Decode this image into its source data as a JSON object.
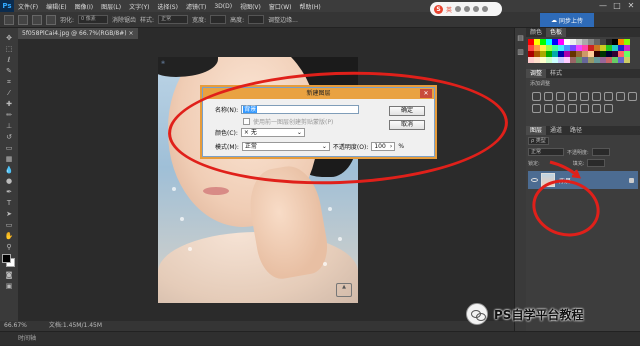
{
  "app": {
    "logo": "Ps"
  },
  "menubar": {
    "items": [
      "文件(F)",
      "编辑(E)",
      "图像(I)",
      "图层(L)",
      "文字(Y)",
      "选择(S)",
      "滤镜(T)",
      "3D(D)",
      "视图(V)",
      "窗口(W)",
      "帮助(H)"
    ]
  },
  "options": {
    "feather_label": "羽化:",
    "feather_value": "0 像素",
    "antialias": "消除锯齿",
    "style_label": "样式:",
    "style_value": "正常",
    "width_label": "宽度:",
    "height_label": "高度:",
    "refine": "调整边缘..."
  },
  "ime": {
    "label": "英",
    "icons": [
      "moon",
      "dot",
      "shirt",
      "grid"
    ]
  },
  "cloud": {
    "label": "同步上传"
  },
  "window_controls": [
    "—",
    "□",
    "✕"
  ],
  "document": {
    "tab_label": "5f058PlCai4.jpg @ 66.7%(RGB/8#) ×"
  },
  "dialog": {
    "title": "新建图层",
    "close": "✕",
    "name_label": "名称(N):",
    "name_value": "背景",
    "name_suffix": "",
    "clip_label": "使用前一图层创建剪贴蒙版(P)",
    "color_label": "颜色(C):",
    "color_value": "× 无",
    "mode_label": "模式(M):",
    "mode_value": "正常",
    "opacity_label": "不透明度(O):",
    "opacity_value": "100",
    "opacity_unit": "%",
    "ok": "确定",
    "cancel": "取消"
  },
  "panels": {
    "color_tabs": [
      "颜色",
      "色板"
    ],
    "adjust_tabs": [
      "调整",
      "样式"
    ],
    "adjust_hint": "添加调整",
    "layers_tabs": [
      "图层",
      "通道",
      "路径"
    ],
    "kind_label": "ρ 类型",
    "blend_mode": "正常",
    "opacity_label": "不透明度:",
    "lock_label": "锁定:",
    "fill_label": "填充:",
    "layer_name": "背景"
  },
  "swatch_colors": [
    "#ff0000",
    "#ffff00",
    "#00ff00",
    "#00ffff",
    "#0000ff",
    "#ff00ff",
    "#ffffff",
    "#eeeeee",
    "#cccccc",
    "#aaaaaa",
    "#888888",
    "#666666",
    "#444444",
    "#222222",
    "#000000",
    "#ff8800",
    "#88ff00",
    "#ff4444",
    "#ff9944",
    "#ffee44",
    "#99ff44",
    "#44ff99",
    "#44eeff",
    "#4499ff",
    "#7744ff",
    "#ee44ff",
    "#ff44aa",
    "#cc2222",
    "#cc7722",
    "#cccc22",
    "#22cc22",
    "#22cccc",
    "#2222cc",
    "#cc22cc",
    "#aa0000",
    "#aa5500",
    "#aaaa00",
    "#00aa00",
    "#00aaaa",
    "#0000aa",
    "#aa00aa",
    "#663300",
    "#996633",
    "#cc9966",
    "#ffcc99",
    "#330000",
    "#003300",
    "#000033",
    "#330033",
    "#ff6666",
    "#66ff66",
    "#ffcccc",
    "#ffe0cc",
    "#ffffcc",
    "#ccffcc",
    "#ccffff",
    "#ccccff",
    "#ffccff",
    "#996666",
    "#669966",
    "#666699",
    "#999966",
    "#669999",
    "#996699",
    "#cc6666",
    "#66cc66",
    "#6666cc",
    "#cccc66"
  ],
  "statusbar": {
    "zoom": "66.67%",
    "doc": "文档:1.45M/1.45M"
  },
  "timeline": {
    "label": "时间轴"
  },
  "watermark": {
    "text": "PS自学平台教程"
  }
}
